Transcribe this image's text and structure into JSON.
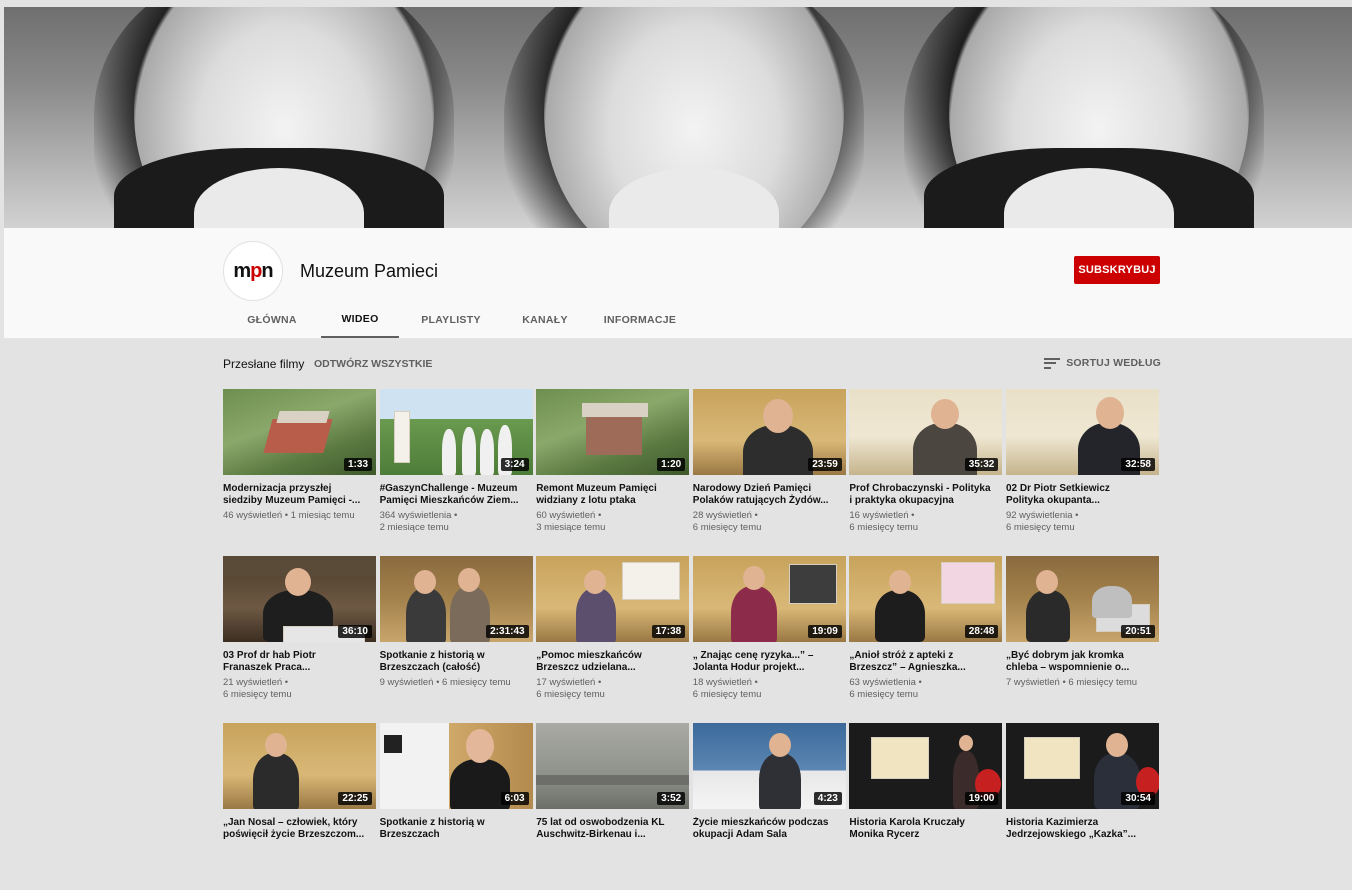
{
  "channel": {
    "name": "Muzeum Pamieci",
    "avatar_text": "mpn",
    "subscribe_label": "SUBSKRYBUJ"
  },
  "tabs": [
    {
      "label": "GŁÓWNA",
      "active": false
    },
    {
      "label": "WIDEO",
      "active": true
    },
    {
      "label": "PLAYLISTY",
      "active": false
    },
    {
      "label": "KANAŁY",
      "active": false
    },
    {
      "label": "INFORMACJE",
      "active": false
    }
  ],
  "section": {
    "title": "Przesłane filmy",
    "play_all": "ODTWÓRZ WSZYSTKIE",
    "sort_label": "SORTUJ WEDŁUG"
  },
  "colors": {
    "subscribe": "#cc0000",
    "background": "#e3e3e3",
    "header": "#f9f9f9"
  },
  "videos": [
    {
      "title": "Modernizacja przyszłej\nsiedziby Muzeum Pamięci -...",
      "duration": "1:33",
      "meta": "46 wyświetleń • 1 miesiąc temu",
      "thumb": "aerial-building-icon"
    },
    {
      "title": "#GaszynChallenge - Muzeum\nPamięci Mieszkańców Ziem...",
      "duration": "3:24",
      "meta": "364 wyświetlenia •\n2 miesiące temu",
      "thumb": "group-park-icon"
    },
    {
      "title": "Remont Muzeum Pamięci\nwidziany z lotu ptaka",
      "duration": "1:20",
      "meta": "60 wyświetleń •\n3 miesiące temu",
      "thumb": "aerial-building-icon"
    },
    {
      "title": "Narodowy Dzień Pamięci\nPolaków ratujących Żydów...",
      "duration": "23:59",
      "meta": "28 wyświetleń •\n6 miesięcy temu",
      "thumb": "speaker-icon"
    },
    {
      "title": "Prof Chrobaczynski - Polityka\ni praktyka okupacyjna",
      "duration": "35:32",
      "meta": "16 wyświetleń •\n6 miesięcy temu",
      "thumb": "speaker-icon"
    },
    {
      "title": "02 Dr Piotr Setkiewicz\nPolityka okupanta...",
      "duration": "32:58",
      "meta": "92 wyświetlenia •\n6 miesięcy temu",
      "thumb": "speaker-icon"
    },
    {
      "title": "03 Prof dr hab Piotr\nFranaszek Praca...",
      "duration": "36:10",
      "meta": "21 wyświetleń •\n6 miesięcy temu",
      "thumb": "lecturer-icon"
    },
    {
      "title": "Spotkanie z historią w\nBrzeszczach (całość)",
      "duration": "2:31:43",
      "meta": "9 wyświetleń • 6 miesięcy temu",
      "thumb": "speaker-icon"
    },
    {
      "title": "„Pomoc mieszkańców\nBrzeszcz udzielana...",
      "duration": "17:38",
      "meta": "17 wyświetleń •\n6 miesięcy temu",
      "thumb": "speaker-icon"
    },
    {
      "title": "„ Znając cenę ryzyka...” –\nJolanta Hodur projekt...",
      "duration": "19:09",
      "meta": "18 wyświetleń •\n6 miesięcy temu",
      "thumb": "speaker-icon"
    },
    {
      "title": "„Anioł stróż z apteki z\nBrzeszcz” – Agnieszka...",
      "duration": "28:48",
      "meta": "63 wyświetlenia •\n6 miesięcy temu",
      "thumb": "speaker-icon"
    },
    {
      "title": "„Być dobrym jak kromka\nchleba – wspomnienie o...",
      "duration": "20:51",
      "meta": "7 wyświetleń • 6 miesięcy temu",
      "thumb": "speaker-icon"
    },
    {
      "title": "„Jan Nosal – człowiek, który\npoświęcił życie Brzeszczom...",
      "duration": "22:25",
      "meta": "",
      "thumb": "lecturer-icon"
    },
    {
      "title": "Spotkanie z historią w\nBrzeszczach",
      "duration": "6:03",
      "meta": "",
      "thumb": "interview-icon"
    },
    {
      "title": "75 lat od oswobodzenia KL\nAuschwitz-Birkenau i...",
      "duration": "3:52",
      "meta": "",
      "thumb": "archive-photo-icon"
    },
    {
      "title": "Życie mieszkańców podczas\nokupacji Adam Sala",
      "duration": "4:23",
      "meta": "",
      "thumb": "speaker-icon"
    },
    {
      "title": "Historia Karola Kruczały\nMonika Rycerz",
      "duration": "19:00",
      "meta": "",
      "thumb": "stage-icon"
    },
    {
      "title": "Historia Kazimierza\nJedrzejowskiego „Kazka”...",
      "duration": "30:54",
      "meta": "",
      "thumb": "stage-icon"
    }
  ]
}
